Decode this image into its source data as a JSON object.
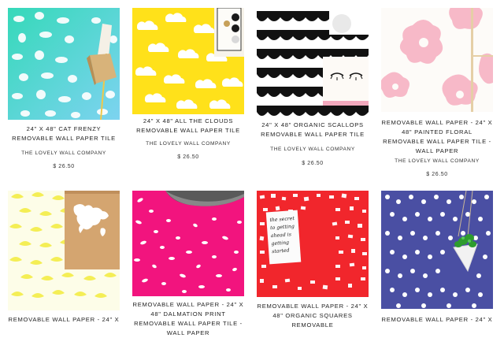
{
  "products": [
    {
      "title": "24\" x 48\" Cat Frenzy Removable Wall Paper Tile",
      "vendor": "THE LOVELY WALL COMPANY",
      "price": "$ 26.50",
      "image": "cat-frenzy-pattern",
      "color": "#4fd2c2"
    },
    {
      "title": "24\" x 48\" All the Clouds Removable Wall Paper Tile",
      "vendor": "THE LOVELY WALL COMPANY",
      "price": "$ 26.50",
      "image": "clouds-pattern",
      "color": "#ffe11a"
    },
    {
      "title": "24\" x 48\" Organic Scallops Removable Wall Paper Tile",
      "vendor": "THE LOVELY WALL COMPANY",
      "price": "$ 26.50",
      "image": "scallops-pattern",
      "color": "#111111"
    },
    {
      "title": "Removable Wall Paper - 24\" x 48\" Painted Floral Removable Wall Paper Tile - Wall Paper",
      "vendor": "THE LOVELY WALL COMPANY",
      "price": "$ 26.50",
      "image": "painted-floral-pattern",
      "color": "#f7b9c8"
    },
    {
      "title": "Removable Wall Paper - 24\" x",
      "vendor": "",
      "price": "",
      "image": "yellow-brush-pattern",
      "color": "#f4ee55"
    },
    {
      "title": "Removable Wall Paper - 24\" x 48\" Dalmation Print Removable Wall Paper Tile - Wall Paper",
      "vendor": "",
      "price": "",
      "image": "pink-dalmation-pattern",
      "color": "#f2147e"
    },
    {
      "title": "Removable Wall Paper - 24\" x 48\" Organic Squares Removable",
      "vendor": "",
      "price": "",
      "image": "red-organic-squares-pattern",
      "color": "#f1262c"
    },
    {
      "title": "Removable Wall Paper - 24\" x",
      "vendor": "",
      "price": "",
      "image": "navy-dots-pattern",
      "color": "#4a4fa3"
    }
  ],
  "image_texts": {
    "print_card": "the secret to getting ahead is getting started"
  }
}
